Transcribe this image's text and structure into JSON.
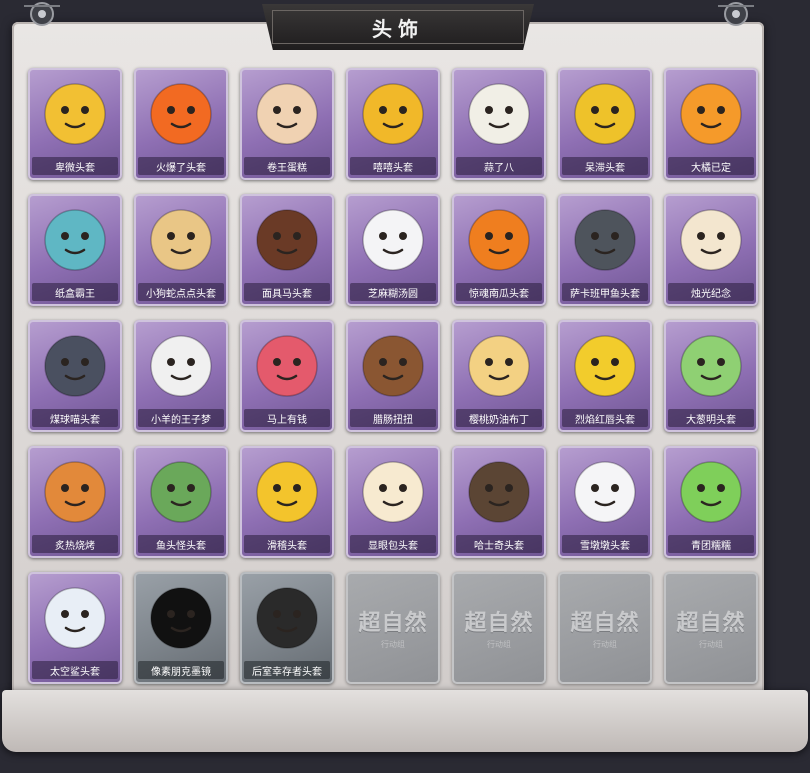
{
  "header": {
    "title": "头饰"
  },
  "items": [
    {
      "label": "卑微头套",
      "icon": "sad-emoji-mask-icon",
      "bg": "#f2c033"
    },
    {
      "label": "火爆了头套",
      "icon": "fire-creature-mask-icon",
      "bg": "#f26a22"
    },
    {
      "label": "卷王蛋糕",
      "icon": "swiss-roll-cake-icon",
      "bg": "#f0d2b2"
    },
    {
      "label": "嘻嘻头套",
      "icon": "grinning-emoji-mask-icon",
      "bg": "#f1b829"
    },
    {
      "label": "蒜了八",
      "icon": "garlic-head-icon",
      "bg": "#f1efe6"
    },
    {
      "label": "呆滞头套",
      "icon": "dazed-emoji-mask-icon",
      "bg": "#eec22a"
    },
    {
      "label": "大橘已定",
      "icon": "orange-slice-head-icon",
      "bg": "#f59a2a"
    },
    {
      "label": "纸盒霸王",
      "icon": "cardboard-dinosaur-head-icon",
      "bg": "#5fb7c4"
    },
    {
      "label": "小狗蛇点点头套",
      "icon": "hamster-mask-icon",
      "bg": "#e9c686"
    },
    {
      "label": "面具马头套",
      "icon": "horse-mask-icon",
      "bg": "#6a3a26"
    },
    {
      "label": "芝麻糊汤圆",
      "icon": "rice-ball-head-icon",
      "bg": "#f4f4f6"
    },
    {
      "label": "惊魂南瓜头套",
      "icon": "pumpkin-head-icon",
      "bg": "#ef7e1f"
    },
    {
      "label": "萨卡班甲鱼头套",
      "icon": "fish-head-icon",
      "bg": "#4e545c"
    },
    {
      "label": "烛光纪念",
      "icon": "candle-head-icon",
      "bg": "#f3e6cf"
    },
    {
      "label": "煤球喵头套",
      "icon": "black-cat-mask-icon",
      "bg": "#4a5060"
    },
    {
      "label": "小羊的王子梦",
      "icon": "sheep-prince-mask-icon",
      "bg": "#f0f0f0"
    },
    {
      "label": "马上有钱",
      "icon": "pink-horse-mask-icon",
      "bg": "#e45a6c"
    },
    {
      "label": "腊肠扭扭",
      "icon": "dachshund-mask-icon",
      "bg": "#8a5632"
    },
    {
      "label": "樱桃奶油布丁",
      "icon": "pudding-head-icon",
      "bg": "#f3d183"
    },
    {
      "label": "烈焰红唇头套",
      "icon": "yellow-mouse-mask-icon",
      "bg": "#f2cc2c"
    },
    {
      "label": "大葱明头套",
      "icon": "scallion-head-icon",
      "bg": "#8fd073"
    },
    {
      "label": "炙热烧烤",
      "icon": "grilled-meat-head-icon",
      "bg": "#e2893a"
    },
    {
      "label": "鱼头怪头套",
      "icon": "fish-monster-mask-icon",
      "bg": "#6aa85a"
    },
    {
      "label": "滑稽头套",
      "icon": "smirk-emoji-mask-icon",
      "bg": "#f3c42c"
    },
    {
      "label": "显眼包头套",
      "icon": "lightbulb-head-icon",
      "bg": "#f7ead0"
    },
    {
      "label": "哈士奇头套",
      "icon": "husky-mask-icon",
      "bg": "#5b4534"
    },
    {
      "label": "雪墩墩头套",
      "icon": "snowman-head-icon",
      "bg": "#f5f5f7"
    },
    {
      "label": "青团糯糯",
      "icon": "green-rice-ball-head-icon",
      "bg": "#7fcf5a"
    },
    {
      "label": "太空鲨头套",
      "icon": "space-shark-head-icon",
      "bg": "#e8eef6"
    },
    {
      "label": "像素朋克墨镜",
      "icon": "pixel-sunglasses-icon",
      "bg": "#111111"
    },
    {
      "label": "后室幸存者头套",
      "icon": "gas-mask-helmet-icon",
      "bg": "#2a2a2a"
    }
  ],
  "grey_items": [
    1,
    2
  ],
  "locked_slots": [
    {
      "mark": "超自然",
      "sub": "行动组"
    },
    {
      "mark": "超自然",
      "sub": "行动组"
    },
    {
      "mark": "超自然",
      "sub": "行动组"
    },
    {
      "mark": "超自然",
      "sub": "行动组"
    }
  ]
}
